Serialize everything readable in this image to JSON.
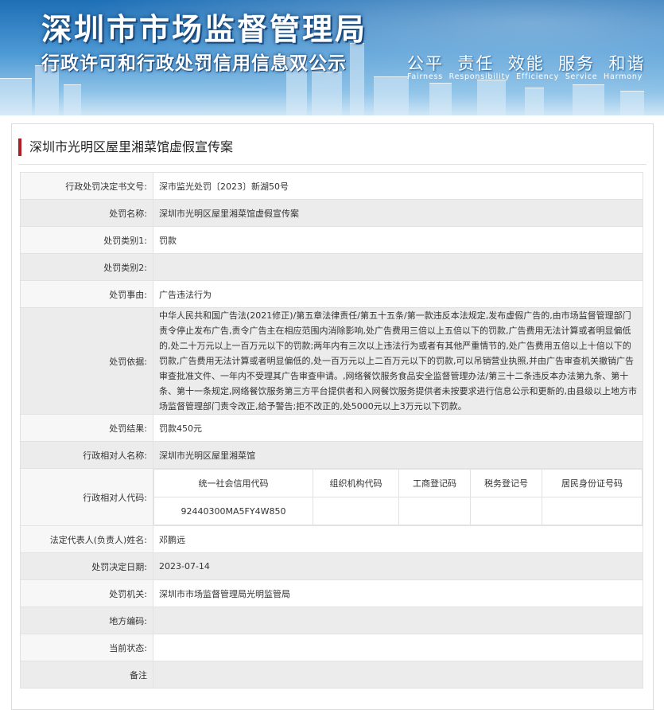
{
  "header": {
    "title": "深圳市市场监督管理局",
    "subtitle": "行政许可和行政处罚信用信息双公示",
    "slogan": "公平  责任  效能  服务  和谐",
    "slogan_en": "Fairness  Responsibility  Efficiency  Service  Harmony"
  },
  "case": {
    "title": "深圳市光明区屋里湘菜馆虚假宣传案",
    "rows": {
      "decision_no_label": "行政处罚决定书文号:",
      "decision_no": "深市监光处罚〔2023〕新湖50号",
      "case_name_label": "处罚名称:",
      "case_name": "深圳市光明区屋里湘菜馆虚假宣传案",
      "category1_label": "处罚类别1:",
      "category1": "罚款",
      "category2_label": "处罚类别2:",
      "category2": "",
      "reason_label": "处罚事由:",
      "reason": "广告违法行为",
      "basis_label": "处罚依据:",
      "basis": "中华人民共和国广告法(2021修正)/第五章法律责任/第五十五条/第一款违反本法规定,发布虚假广告的,由市场监督管理部门责令停止发布广告,责令广告主在相应范围内消除影响,处广告费用三倍以上五倍以下的罚款,广告费用无法计算或者明显偏低的,处二十万元以上一百万元以下的罚款;两年内有三次以上违法行为或者有其他严重情节的,处广告费用五倍以上十倍以下的罚款,广告费用无法计算或者明显偏低的,处一百万元以上二百万元以下的罚款,可以吊销营业执照,并由广告审查机关撤销广告审查批准文件、一年内不受理其广告审查申请。,网络餐饮服务食品安全监督管理办法/第三十二条违反本办法第九条、第十条、第十一条规定,网络餐饮服务第三方平台提供者和入网餐饮服务提供者未按要求进行信息公示和更新的,由县级以上地方市场监督管理部门责令改正,给予警告;拒不改正的,处5000元以上3万元以下罚款。",
      "result_label": "处罚结果:",
      "result": "罚款450元",
      "party_name_label": "行政相对人名称:",
      "party_name": "深圳市光明区屋里湘菜馆",
      "party_code_label": "行政相对人代码:",
      "code_headers": [
        "统一社会信用代码",
        "组织机构代码",
        "工商登记码",
        "税务登记号",
        "居民身份证号码"
      ],
      "code_values": [
        "92440300MA5FY4W850",
        "",
        "",
        "",
        ""
      ],
      "legal_rep_label": "法定代表人(负责人)姓名:",
      "legal_rep": "邓鹏远",
      "decision_date_label": "处罚决定日期:",
      "decision_date": "2023-07-14",
      "authority_label": "处罚机关:",
      "authority": "深圳市市场监督管理局光明监管局",
      "area_code_label": "地方编码:",
      "area_code": "",
      "status_label": "当前状态:",
      "status": "",
      "remark_label": "备注",
      "remark": ""
    }
  },
  "colors": {
    "accent_bar": "#b01e23",
    "banner_top": "#1f6fb6",
    "alt_row": "#ececec"
  }
}
